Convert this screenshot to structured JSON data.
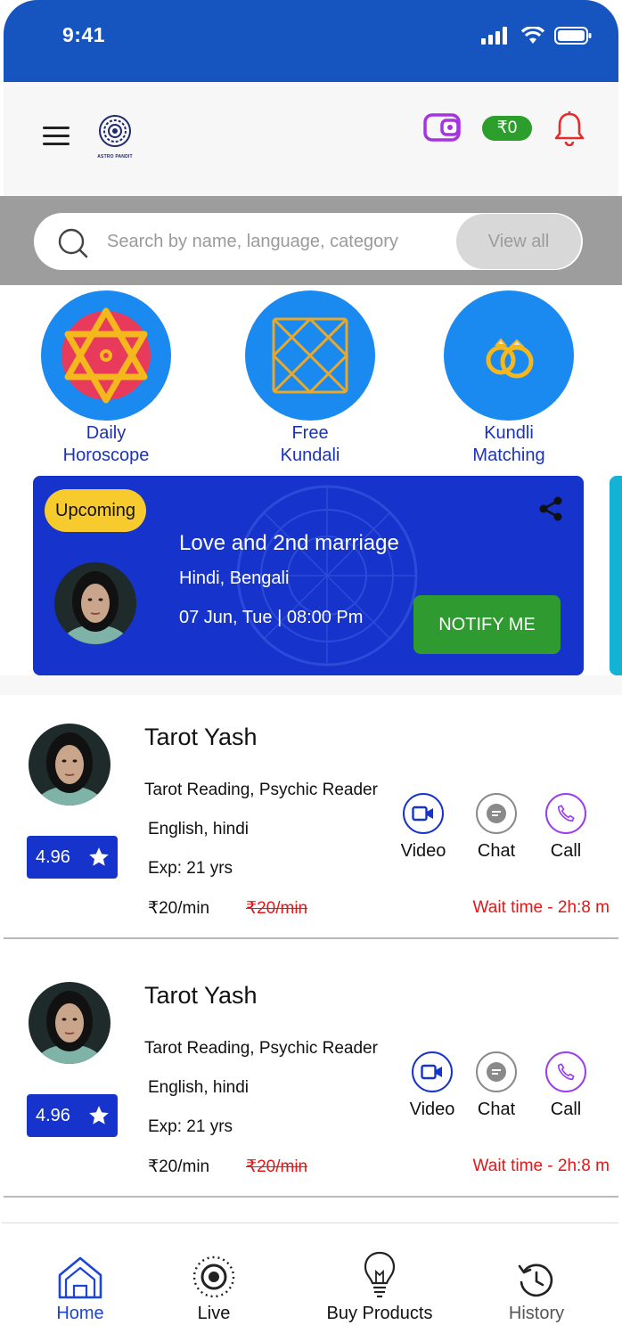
{
  "status_bar": {
    "time": "9:41"
  },
  "header": {
    "logo_text": "ASTRO PANDIT",
    "wallet_balance": "₹0"
  },
  "search": {
    "placeholder": "Search by name, language, category",
    "view_all_label": "View all"
  },
  "categories": [
    {
      "label_line1": "Daily",
      "label_line2": "Horoscope",
      "icon": "hexagram-icon"
    },
    {
      "label_line1": "Free",
      "label_line2": "Kundali",
      "icon": "kundali-chart-icon"
    },
    {
      "label_line1": "Kundli",
      "label_line2": "Matching",
      "icon": "rings-icon"
    }
  ],
  "live_event": {
    "badge": "Upcoming",
    "title": "Love and 2nd marriage",
    "languages": "Hindi, Bengali",
    "datetime": "07 Jun, Tue | 08:00 Pm",
    "cta": "NOTIFY ME"
  },
  "astrologers": [
    {
      "name": "Tarot Yash",
      "skills": "Tarot Reading, Psychic Reader",
      "languages": "English, hindi",
      "experience": "Exp: 21 yrs",
      "rating": "4.96",
      "price": "₹20/min",
      "old_price": "₹20/min",
      "wait_time": "Wait time - 2h:8 m",
      "actions": {
        "video": "Video",
        "chat": "Chat",
        "call": "Call"
      }
    },
    {
      "name": "Tarot Yash",
      "skills": "Tarot Reading, Psychic Reader",
      "languages": "English, hindi",
      "experience": "Exp: 21 yrs",
      "rating": "4.96",
      "price": "₹20/min",
      "old_price": "₹20/min",
      "wait_time": "Wait time - 2h:8 m",
      "actions": {
        "video": "Video",
        "chat": "Chat",
        "call": "Call"
      }
    }
  ],
  "bottom_nav": [
    {
      "label": "Home",
      "icon": "home-icon",
      "active": true
    },
    {
      "label": "Live",
      "icon": "live-icon",
      "active": false
    },
    {
      "label": "Buy Products",
      "icon": "bulb-icon",
      "active": false
    },
    {
      "label": "History",
      "icon": "history-icon",
      "active": false
    }
  ],
  "colors": {
    "primary_blue": "#1634cc",
    "status_bar_blue": "#1655c0",
    "category_blue": "#1a8af0",
    "badge_yellow": "#f7cb2e",
    "cta_green": "#2f9a2f",
    "alert_red": "#e01818",
    "call_purple": "#9b3df0"
  }
}
